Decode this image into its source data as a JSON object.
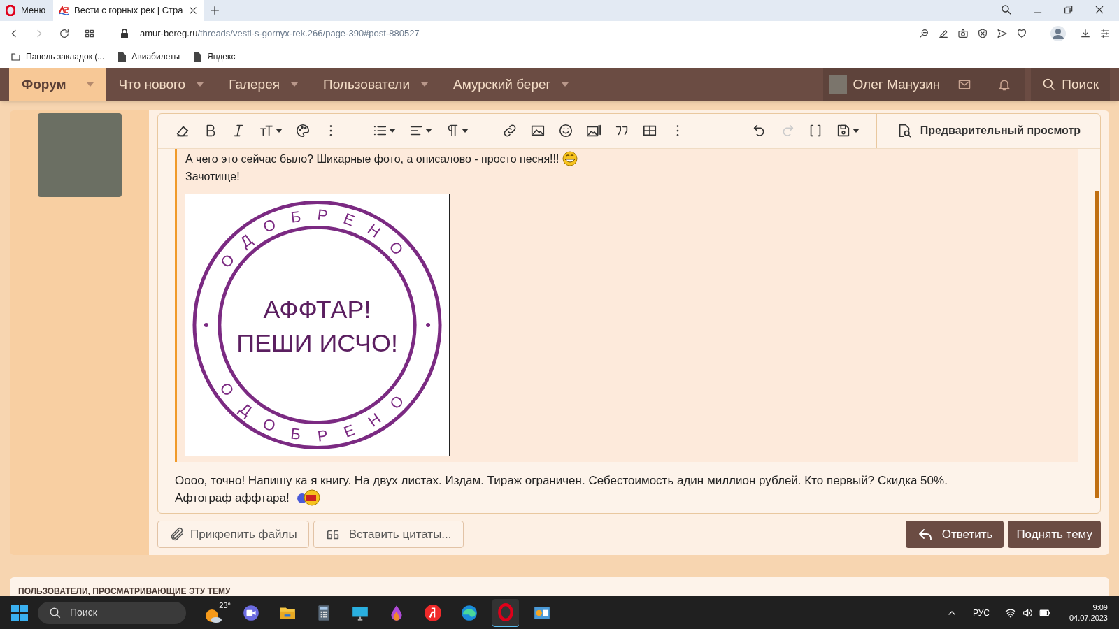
{
  "browser": {
    "tabs": [
      {
        "kind": "menu",
        "label": "Меню",
        "selected": false
      },
      {
        "kind": "page",
        "label": "Вести с горных рек | Стра",
        "selected": true
      }
    ],
    "address": {
      "domain": "amur-bereg.ru",
      "path": "/threads/vesti-s-gornyx-rek.266/page-390#post-880527"
    },
    "bookmarks": [
      {
        "kind": "folder",
        "label": "Панель закладок (..."
      },
      {
        "kind": "page",
        "label": "Авиабилеты"
      },
      {
        "kind": "page",
        "label": "Яндекс"
      }
    ]
  },
  "nav": {
    "items": [
      {
        "label": "Форум",
        "selected": true
      },
      {
        "label": "Что нового",
        "selected": false
      },
      {
        "label": "Галерея",
        "selected": false
      },
      {
        "label": "Пользователи",
        "selected": false
      },
      {
        "label": "Амурский берег",
        "selected": false
      }
    ],
    "user": "Олег Манузин",
    "search": "Поиск"
  },
  "editor": {
    "preview": "Предварительный просмотр",
    "quote": {
      "lines": [
        "А чего это сейчас было? Шикарные фото, а описалово - просто песня!!!",
        "Зачотище!"
      ],
      "stamp": {
        "ring_text": [
          "ОДОБРЕНО",
          "ОДОБРЕНО"
        ],
        "center_lines": [
          "АФФТАР!",
          "ПЕШИ ИСЧО!"
        ]
      }
    },
    "message": [
      "Оооо, точно! Напишу ка я книгу. На двух листах. Издам. Тираж ограничен. Себестоимость адин миллион рублей. Кто первый? Скидка 50%.",
      "Афтограф аффтара!"
    ]
  },
  "buttons": {
    "attach": "Прикрепить файлы",
    "insert_quotes": "Вставить цитаты...",
    "reply": "Ответить",
    "bump": "Поднять тему"
  },
  "section_heading": "ПОЛЬЗОВАТЕЛИ, ПРОСМАТРИВАЮЩИЕ ЭТУ ТЕМУ",
  "taskbar": {
    "search": "Поиск",
    "weather": "23°",
    "language": "РУС",
    "time": "9:09",
    "date": "04.07.2023"
  }
}
